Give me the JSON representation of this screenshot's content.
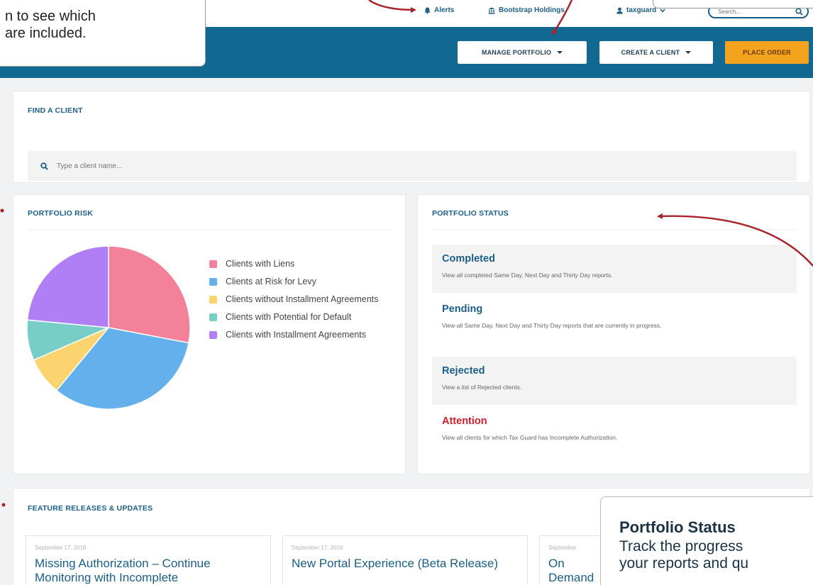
{
  "top_nav": {
    "alerts": "Alerts",
    "company": "Bootstrap Holdings",
    "user": "taxguard",
    "search_placeholder": "Search..."
  },
  "header": {
    "manage_portfolio": "MANAGE PORTFOLIO",
    "create_client": "CREATE A CLIENT",
    "place_order": "PLACE ORDER"
  },
  "find_client": {
    "title": "FIND A CLIENT",
    "placeholder": "Type a client name..."
  },
  "portfolio_risk": {
    "title": "PORTFOLIO RISK",
    "legend": [
      {
        "label": "Clients with Liens",
        "color": "#f4819a"
      },
      {
        "label": "Clients at Risk for Levy",
        "color": "#63b0ed"
      },
      {
        "label": "Clients without Installment Agreements",
        "color": "#fbd46f"
      },
      {
        "label": "Clients with Potential for Default",
        "color": "#76cec6"
      },
      {
        "label": "Clients with Installment Agreements",
        "color": "#b07ff6"
      }
    ]
  },
  "chart_data": {
    "type": "pie",
    "categories": [
      "Clients with Liens",
      "Clients at Risk for Levy",
      "Clients without Installment Agreements",
      "Clients with Potential for Default",
      "Clients with Installment Agreements"
    ],
    "values": [
      28,
      33,
      7.5,
      8,
      23.5
    ],
    "colors": [
      "#f4819a",
      "#63b0ed",
      "#fbd46f",
      "#76cec6",
      "#b07ff6"
    ]
  },
  "portfolio_status": {
    "title": "PORTFOLIO STATUS",
    "items": [
      {
        "title": "Completed",
        "desc": "View all completed Same Day, Next Day and Thirty Day reports."
      },
      {
        "title": "Pending",
        "desc": "View all Same Day, Next Day and Thirty Day reports that are currently in progress."
      },
      {
        "title": "Rejected",
        "desc": "View a list of Rejected clients."
      },
      {
        "title": "Attention",
        "desc": "View all clients for which Tax Guard has Incomplete Authorization."
      }
    ]
  },
  "releases": {
    "title": "FEATURE RELEASES & UPDATES",
    "items": [
      {
        "date": "September 17, 2018",
        "title": "Missing Authorization – Continue Monitoring with Incomplete"
      },
      {
        "date": "September 17, 2018",
        "title": "New Portal Experience (Beta Release)"
      },
      {
        "date": "September",
        "title": "On Demand Lenders"
      }
    ]
  },
  "callouts": {
    "left_line1": "n to see which",
    "left_line2": "are included.",
    "tip_title": "Portfolio Status",
    "tip_line1": "Track the progress",
    "tip_line2": "your reports and qu"
  },
  "colors": {
    "brand_blue": "#116890",
    "accent_orange": "#f4a31f",
    "attention_red": "#d21c2a",
    "arrow_red": "#a8242c"
  }
}
